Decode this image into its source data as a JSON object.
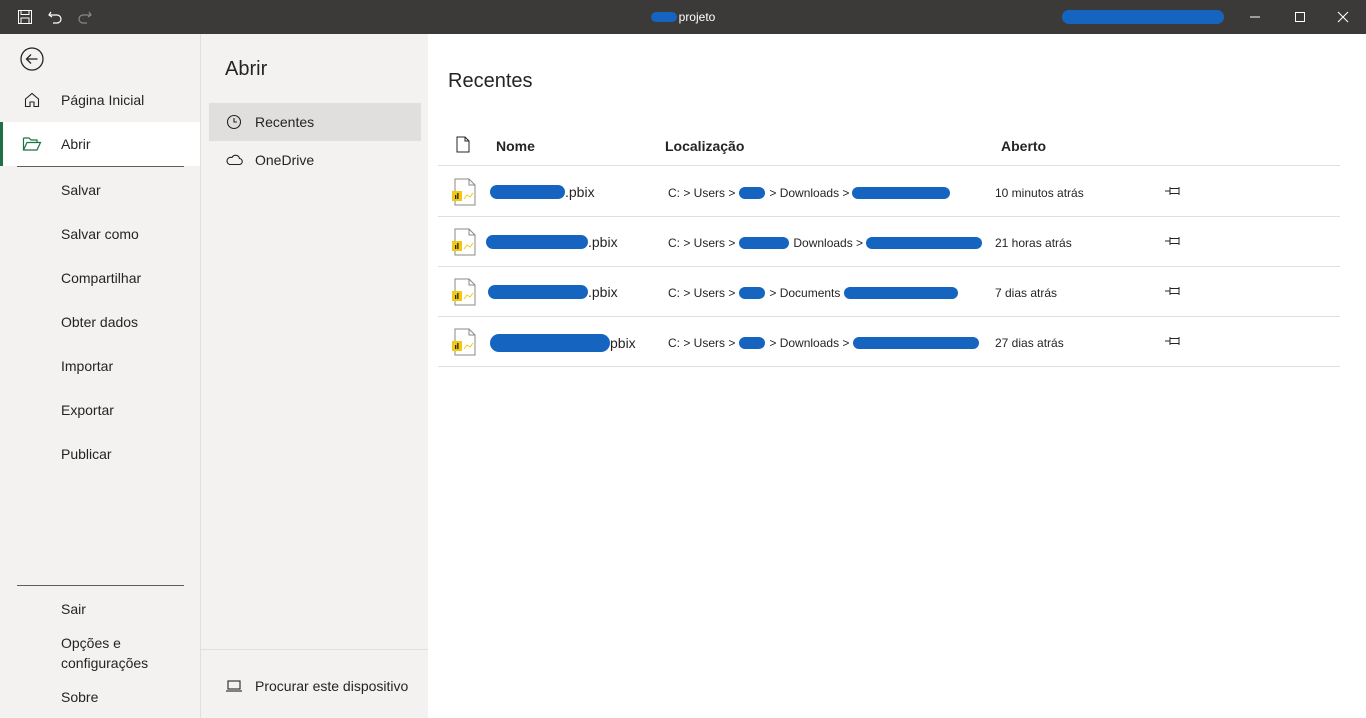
{
  "titlebar": {
    "title": "projeto",
    "icons": [
      "save-icon",
      "undo-icon",
      "redo-icon"
    ],
    "window_buttons": [
      "minimize-icon",
      "maximize-icon",
      "close-icon"
    ]
  },
  "leftnav": {
    "back_icon": "back-arrow-icon",
    "items": [
      {
        "label": "Página Inicial",
        "icon": "home-icon"
      },
      {
        "label": "Abrir",
        "icon": "folder-open-icon",
        "active": true
      }
    ],
    "subitems": [
      "Salvar",
      "Salvar como",
      "Compartilhar",
      "Obter dados",
      "Importar",
      "Exportar",
      "Publicar"
    ],
    "bottom": {
      "sair": "Sair",
      "opcoes_line1": "Opções e",
      "opcoes_line2": "configurações",
      "sobre": "Sobre"
    }
  },
  "midpane": {
    "title": "Abrir",
    "items": [
      {
        "label": "Recentes",
        "icon": "clock-icon",
        "active": true
      },
      {
        "label": "OneDrive",
        "icon": "cloud-icon"
      }
    ],
    "browse": {
      "label": "Procurar este dispositivo",
      "icon": "laptop-icon"
    }
  },
  "main": {
    "title": "Recentes",
    "columns": {
      "icon": "file-icon",
      "name": "Nome",
      "location": "Localização",
      "opened": "Aberto"
    },
    "rows": [
      {
        "name_suffix": ".pbix",
        "loc_prefix": "C: > Users >",
        "loc_folder": "> Downloads >",
        "opened": "10 minutos atrás"
      },
      {
        "name_suffix": ".pbix",
        "loc_prefix": "C: > Users >",
        "loc_folder": "Downloads >",
        "opened": "21 horas atrás"
      },
      {
        "name_suffix": ".pbix",
        "loc_prefix": "C: > Users >",
        "loc_folder": "> Documents",
        "opened": "7 dias atrás"
      },
      {
        "name_suffix": "pbix",
        "loc_prefix": "C: > Users >",
        "loc_folder": "> Downloads >",
        "opened": "27 dias atrás"
      }
    ],
    "accent": "#1e7145",
    "redaction_color": "#1565c0"
  }
}
